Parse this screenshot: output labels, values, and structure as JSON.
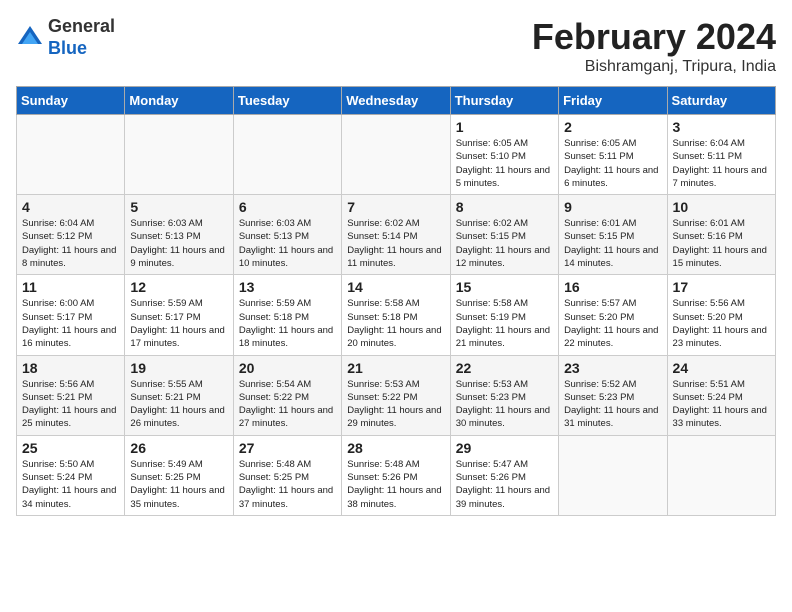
{
  "logo": {
    "general": "General",
    "blue": "Blue"
  },
  "title": "February 2024",
  "subtitle": "Bishramganj, Tripura, India",
  "days_of_week": [
    "Sunday",
    "Monday",
    "Tuesday",
    "Wednesday",
    "Thursday",
    "Friday",
    "Saturday"
  ],
  "weeks": [
    [
      {
        "day": "",
        "info": ""
      },
      {
        "day": "",
        "info": ""
      },
      {
        "day": "",
        "info": ""
      },
      {
        "day": "",
        "info": ""
      },
      {
        "day": "1",
        "info": "Sunrise: 6:05 AM\nSunset: 5:10 PM\nDaylight: 11 hours and 5 minutes."
      },
      {
        "day": "2",
        "info": "Sunrise: 6:05 AM\nSunset: 5:11 PM\nDaylight: 11 hours and 6 minutes."
      },
      {
        "day": "3",
        "info": "Sunrise: 6:04 AM\nSunset: 5:11 PM\nDaylight: 11 hours and 7 minutes."
      }
    ],
    [
      {
        "day": "4",
        "info": "Sunrise: 6:04 AM\nSunset: 5:12 PM\nDaylight: 11 hours and 8 minutes."
      },
      {
        "day": "5",
        "info": "Sunrise: 6:03 AM\nSunset: 5:13 PM\nDaylight: 11 hours and 9 minutes."
      },
      {
        "day": "6",
        "info": "Sunrise: 6:03 AM\nSunset: 5:13 PM\nDaylight: 11 hours and 10 minutes."
      },
      {
        "day": "7",
        "info": "Sunrise: 6:02 AM\nSunset: 5:14 PM\nDaylight: 11 hours and 11 minutes."
      },
      {
        "day": "8",
        "info": "Sunrise: 6:02 AM\nSunset: 5:15 PM\nDaylight: 11 hours and 12 minutes."
      },
      {
        "day": "9",
        "info": "Sunrise: 6:01 AM\nSunset: 5:15 PM\nDaylight: 11 hours and 14 minutes."
      },
      {
        "day": "10",
        "info": "Sunrise: 6:01 AM\nSunset: 5:16 PM\nDaylight: 11 hours and 15 minutes."
      }
    ],
    [
      {
        "day": "11",
        "info": "Sunrise: 6:00 AM\nSunset: 5:17 PM\nDaylight: 11 hours and 16 minutes."
      },
      {
        "day": "12",
        "info": "Sunrise: 5:59 AM\nSunset: 5:17 PM\nDaylight: 11 hours and 17 minutes."
      },
      {
        "day": "13",
        "info": "Sunrise: 5:59 AM\nSunset: 5:18 PM\nDaylight: 11 hours and 18 minutes."
      },
      {
        "day": "14",
        "info": "Sunrise: 5:58 AM\nSunset: 5:18 PM\nDaylight: 11 hours and 20 minutes."
      },
      {
        "day": "15",
        "info": "Sunrise: 5:58 AM\nSunset: 5:19 PM\nDaylight: 11 hours and 21 minutes."
      },
      {
        "day": "16",
        "info": "Sunrise: 5:57 AM\nSunset: 5:20 PM\nDaylight: 11 hours and 22 minutes."
      },
      {
        "day": "17",
        "info": "Sunrise: 5:56 AM\nSunset: 5:20 PM\nDaylight: 11 hours and 23 minutes."
      }
    ],
    [
      {
        "day": "18",
        "info": "Sunrise: 5:56 AM\nSunset: 5:21 PM\nDaylight: 11 hours and 25 minutes."
      },
      {
        "day": "19",
        "info": "Sunrise: 5:55 AM\nSunset: 5:21 PM\nDaylight: 11 hours and 26 minutes."
      },
      {
        "day": "20",
        "info": "Sunrise: 5:54 AM\nSunset: 5:22 PM\nDaylight: 11 hours and 27 minutes."
      },
      {
        "day": "21",
        "info": "Sunrise: 5:53 AM\nSunset: 5:22 PM\nDaylight: 11 hours and 29 minutes."
      },
      {
        "day": "22",
        "info": "Sunrise: 5:53 AM\nSunset: 5:23 PM\nDaylight: 11 hours and 30 minutes."
      },
      {
        "day": "23",
        "info": "Sunrise: 5:52 AM\nSunset: 5:23 PM\nDaylight: 11 hours and 31 minutes."
      },
      {
        "day": "24",
        "info": "Sunrise: 5:51 AM\nSunset: 5:24 PM\nDaylight: 11 hours and 33 minutes."
      }
    ],
    [
      {
        "day": "25",
        "info": "Sunrise: 5:50 AM\nSunset: 5:24 PM\nDaylight: 11 hours and 34 minutes."
      },
      {
        "day": "26",
        "info": "Sunrise: 5:49 AM\nSunset: 5:25 PM\nDaylight: 11 hours and 35 minutes."
      },
      {
        "day": "27",
        "info": "Sunrise: 5:48 AM\nSunset: 5:25 PM\nDaylight: 11 hours and 37 minutes."
      },
      {
        "day": "28",
        "info": "Sunrise: 5:48 AM\nSunset: 5:26 PM\nDaylight: 11 hours and 38 minutes."
      },
      {
        "day": "29",
        "info": "Sunrise: 5:47 AM\nSunset: 5:26 PM\nDaylight: 11 hours and 39 minutes."
      },
      {
        "day": "",
        "info": ""
      },
      {
        "day": "",
        "info": ""
      }
    ]
  ]
}
